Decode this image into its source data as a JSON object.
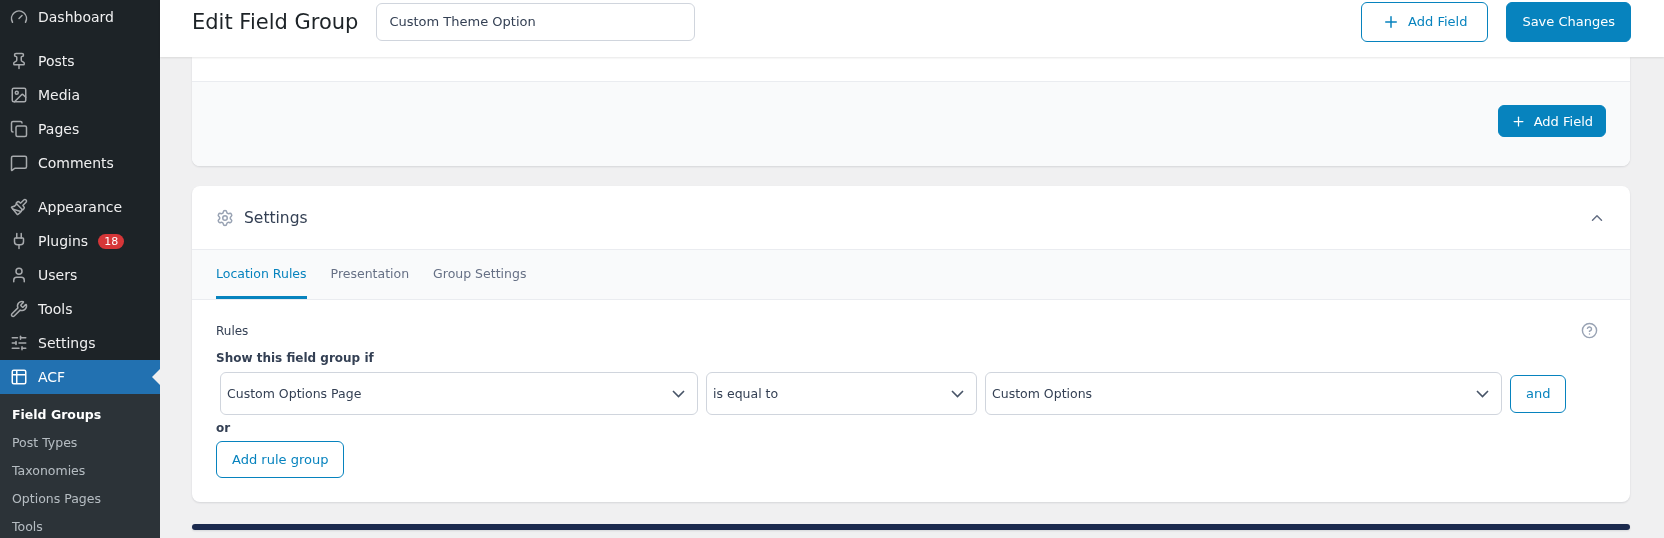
{
  "sidebar": {
    "groups": [
      {
        "items": [
          {
            "label": "Dashboard",
            "selected": false
          }
        ]
      },
      {
        "items": [
          {
            "label": "Posts",
            "selected": false
          },
          {
            "label": "Media",
            "selected": false
          },
          {
            "label": "Pages",
            "selected": false
          },
          {
            "label": "Comments",
            "selected": false
          }
        ]
      },
      {
        "items": [
          {
            "label": "Appearance",
            "selected": false
          },
          {
            "label": "Plugins",
            "selected": false,
            "badge": "18"
          },
          {
            "label": "Users",
            "selected": false
          },
          {
            "label": "Tools",
            "selected": false
          },
          {
            "label": "Settings",
            "selected": false
          },
          {
            "label": "ACF",
            "selected": true
          }
        ]
      }
    ],
    "submenu": [
      {
        "label": "Field Groups",
        "selected": true
      },
      {
        "label": "Post Types",
        "selected": false
      },
      {
        "label": "Taxonomies",
        "selected": false
      },
      {
        "label": "Options Pages",
        "selected": false
      },
      {
        "label": "Tools",
        "selected": false
      }
    ]
  },
  "header": {
    "title": "Edit Field Group",
    "title_field": {
      "value": "Custom Theme Option"
    },
    "buttons": [
      {
        "label": "Add Field",
        "kind": "outline"
      },
      {
        "label": "Save Changes",
        "kind": "primary"
      }
    ]
  },
  "fields_card": {
    "button": {
      "label": "Add Field"
    }
  },
  "settings": {
    "title": "Settings",
    "expanded": true,
    "tabs": [
      {
        "label": "Location Rules",
        "selected": true
      },
      {
        "label": "Presentation",
        "selected": false
      },
      {
        "label": "Group Settings",
        "selected": false
      }
    ],
    "rules_label": "Rules",
    "condition_label": "Show this field group if",
    "rule": {
      "param": "Custom Options Page",
      "operator": "is equal to",
      "value": "Custom Options",
      "and_button": "and"
    },
    "or_label": "or",
    "add_group_button": "Add rule group"
  }
}
